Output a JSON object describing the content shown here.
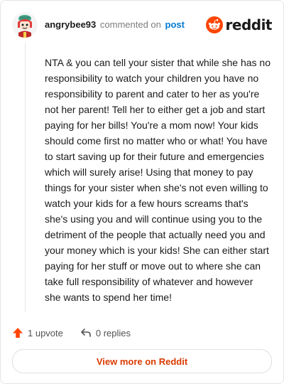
{
  "header": {
    "username": "angrybee93",
    "action_text": "commented on",
    "post_link": "post",
    "brand_name": "reddit",
    "brand_color": "#ff4500"
  },
  "comment": {
    "body": "NTA & you can tell your sister that while she has no responsibility to watch your children you have no responsibility to parent and cater to her as you're not her parent! Tell her to either get a job and start paying for her bills! You're a mom now! Your kids should come first no matter who or what! You have to start saving up for their future and emergencies which will surely arise! Using that money to pay things for your sister when she's not even willing to watch your kids for a few hours screams that's she's using you and will continue using you to the detriment of the people that actually need you and your money which is your kids! She can either start paying for her stuff or move out to where she can take full responsibility of whatever and however she wants to spend her time!"
  },
  "actions": {
    "upvote_label": "1 upvote",
    "upvote_icon": "upvote-arrow-icon",
    "replies_label": "0 replies",
    "replies_icon": "reply-arrow-icon",
    "upvote_color": "#ff4500"
  },
  "footer": {
    "view_more_label": "View more on Reddit",
    "link_color": "#d93a00"
  }
}
